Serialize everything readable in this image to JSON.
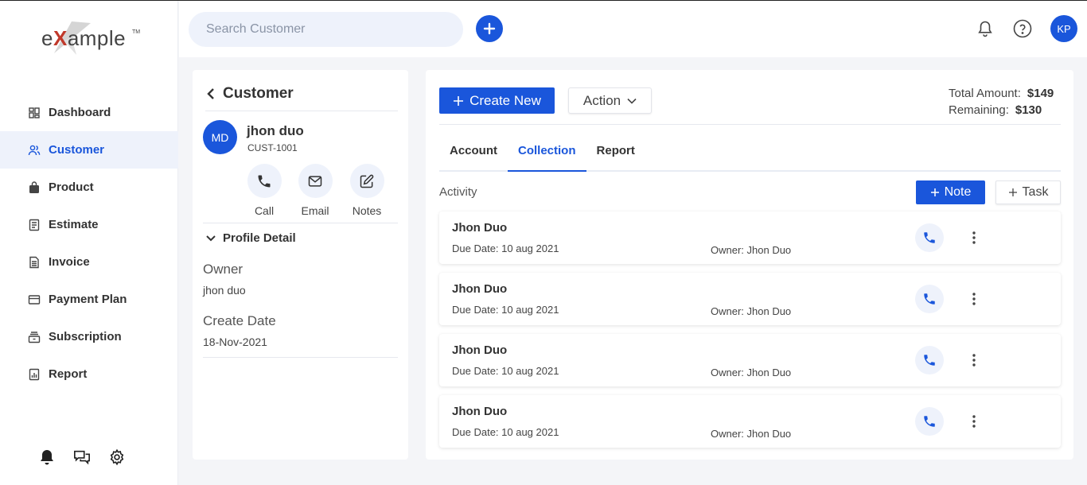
{
  "brand": {
    "logo_text_prefix": "e",
    "logo_text_x": "X",
    "logo_text_suffix": "ample",
    "logo_tm": "TM"
  },
  "sidebar": {
    "items": [
      {
        "label": "Dashboard",
        "icon": "dashboard-icon"
      },
      {
        "label": "Customer",
        "icon": "users-icon",
        "active": true
      },
      {
        "label": "Product",
        "icon": "bag-icon"
      },
      {
        "label": "Estimate",
        "icon": "document-icon"
      },
      {
        "label": "Invoice",
        "icon": "invoice-icon"
      },
      {
        "label": "Payment Plan",
        "icon": "card-icon"
      },
      {
        "label": "Subscription",
        "icon": "subscription-icon"
      },
      {
        "label": "Report",
        "icon": "report-icon"
      }
    ],
    "bottom_icons": [
      "bell-icon",
      "chat-icon",
      "gear-icon"
    ]
  },
  "topbar": {
    "search_placeholder": "Search Customer",
    "avatar_initials": "KP",
    "icons": [
      "plus-icon",
      "bell-icon",
      "help-icon"
    ]
  },
  "customer": {
    "header": "Customer",
    "avatar_initials": "MD",
    "name": "jhon duo",
    "id": "CUST-1001",
    "actions": [
      {
        "label": "Call",
        "icon": "phone-icon"
      },
      {
        "label": "Email",
        "icon": "mail-icon"
      },
      {
        "label": "Notes",
        "icon": "edit-icon"
      }
    ],
    "profile_title": "Profile Detail",
    "owner_label": "Owner",
    "owner_value": "jhon duo",
    "create_date_label": "Create Date",
    "create_date_value": "18-Nov-2021"
  },
  "main": {
    "create_label": "Create New",
    "action_label": "Action",
    "total_amount_label": "Total Amount:",
    "total_amount_value": "$149",
    "remaining_label": "Remaining:",
    "remaining_value": "$130",
    "tabs": [
      {
        "label": "Account"
      },
      {
        "label": "Collection",
        "active": true
      },
      {
        "label": "Report"
      }
    ],
    "activity_label": "Activity",
    "note_label": "Note",
    "task_label": "Task",
    "activities": [
      {
        "name": "Jhon Duo",
        "due": "Due Date: 10 aug 2021",
        "owner": "Owner: Jhon Duo"
      },
      {
        "name": "Jhon Duo",
        "due": "Due Date: 10 aug 2021",
        "owner": "Owner: Jhon Duo"
      },
      {
        "name": "Jhon Duo",
        "due": "Due Date: 10 aug 2021",
        "owner": "Owner: Jhon Duo"
      },
      {
        "name": "Jhon Duo",
        "due": "Due Date: 10 aug 2021",
        "owner": "Owner: Jhon Duo"
      }
    ]
  },
  "colors": {
    "accent": "#1a56db",
    "accent_light": "#eef2fb",
    "background": "#f4f5f8"
  }
}
